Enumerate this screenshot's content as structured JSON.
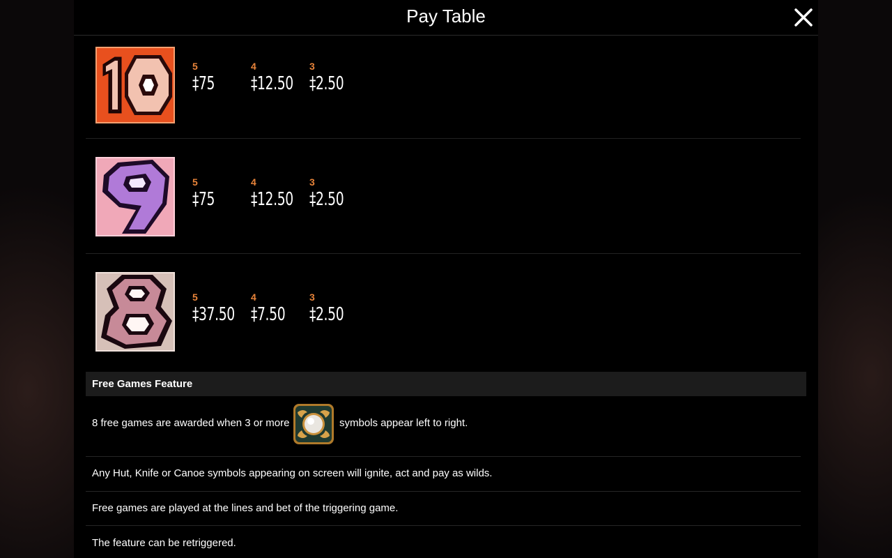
{
  "header": {
    "title": "Pay Table"
  },
  "paytable": [
    {
      "symbol": "ten-symbol",
      "pays": [
        {
          "count": "5",
          "amount": "‡75"
        },
        {
          "count": "4",
          "amount": "‡12.50"
        },
        {
          "count": "3",
          "amount": "‡2.50"
        }
      ]
    },
    {
      "symbol": "nine-symbol",
      "pays": [
        {
          "count": "5",
          "amount": "‡75"
        },
        {
          "count": "4",
          "amount": "‡12.50"
        },
        {
          "count": "3",
          "amount": "‡2.50"
        }
      ]
    },
    {
      "symbol": "eight-symbol",
      "pays": [
        {
          "count": "5",
          "amount": "‡37.50"
        },
        {
          "count": "4",
          "amount": "‡7.50"
        },
        {
          "count": "3",
          "amount": "‡2.50"
        }
      ]
    }
  ],
  "feature": {
    "heading": "Free Games Feature",
    "line1_before": "8 free games are awarded when 3 or more",
    "line1_after": "symbols appear left to right.",
    "line2": "Any Hut, Knife or Canoe symbols appearing on screen will ignite, act and pay as wilds.",
    "line3": "Free games are played at the lines and bet of the triggering game.",
    "line4": "The feature can be retriggered."
  },
  "colors": {
    "accent": "#e8843a",
    "ten": "#e8501e",
    "nine": "#b07ad8",
    "eight": "#d9a0a8"
  }
}
